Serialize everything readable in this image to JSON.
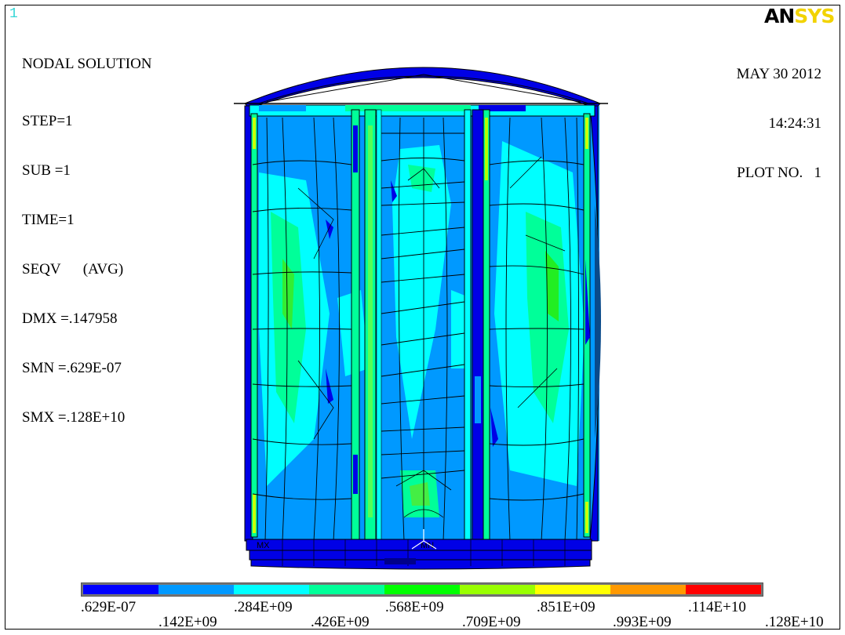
{
  "window_number": "1",
  "logo": {
    "part1": "AN",
    "part2": "SYS"
  },
  "solution": {
    "title": "NODAL SOLUTION",
    "step": "STEP=1",
    "sub": "SUB =1",
    "time": "TIME=1",
    "seqv": "SEQV      (AVG)",
    "dmx": "DMX =.147958",
    "smn": "SMN =.629E-07",
    "smx": "SMX =.128E+10"
  },
  "datetime": {
    "date": "MAY 30 2012",
    "time": "14:24:31",
    "plot_no": "PLOT NO.   1"
  },
  "colorbar": {
    "colors": [
      "#0000ff",
      "#0099ff",
      "#00ffff",
      "#00ff99",
      "#00ff00",
      "#99ff00",
      "#ffff00",
      "#ff9900",
      "#ff0000"
    ],
    "labels": [
      ".629E-07",
      ".142E+09",
      ".284E+09",
      ".426E+09",
      ".568E+09",
      ".709E+09",
      ".851E+09",
      ".993E+09",
      ".114E+10",
      ".128E+10"
    ]
  },
  "markers": {
    "mx": "MX",
    "mn": "MN"
  }
}
